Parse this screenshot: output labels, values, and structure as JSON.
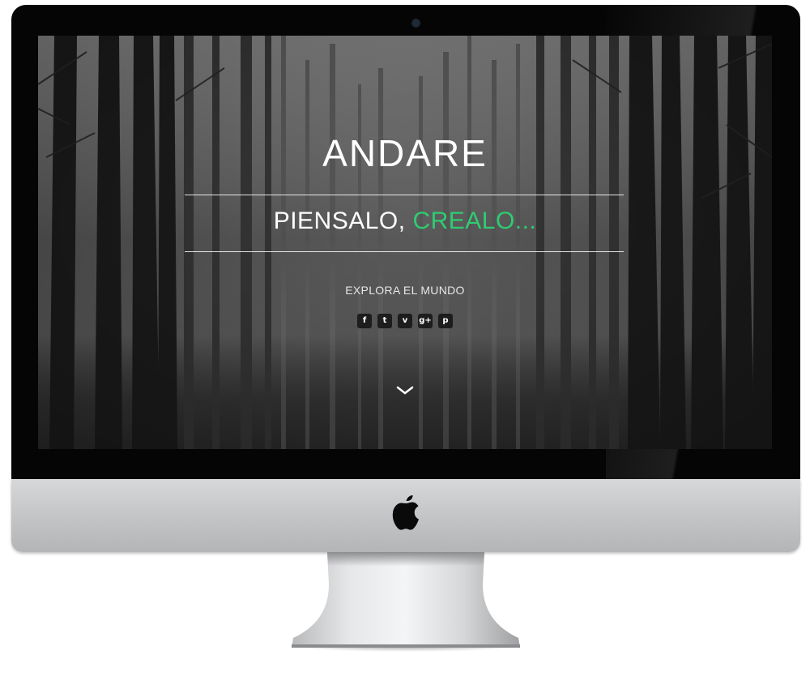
{
  "device": {
    "type": "imac",
    "bezel_color": "#050505",
    "chin_color": "#c4c5c7"
  },
  "website": {
    "title": "ANDARE",
    "tagline": {
      "main": "PIENSALO,",
      "accent": "CREALO..."
    },
    "subtitle": "EXPLORA EL MUNDO",
    "accent_color": "#2ecc71",
    "background": "forest-image",
    "social_links": [
      {
        "name": "facebook",
        "icon": "facebook-icon",
        "glyph": "f"
      },
      {
        "name": "twitter",
        "icon": "twitter-icon",
        "glyph": "t"
      },
      {
        "name": "vimeo",
        "icon": "vimeo-icon",
        "glyph": "v"
      },
      {
        "name": "google-plus",
        "icon": "google-plus-icon",
        "glyph": "g+"
      },
      {
        "name": "pinterest",
        "icon": "pinterest-icon",
        "glyph": "p"
      }
    ],
    "scroll_icon": "chevron-down-icon"
  }
}
